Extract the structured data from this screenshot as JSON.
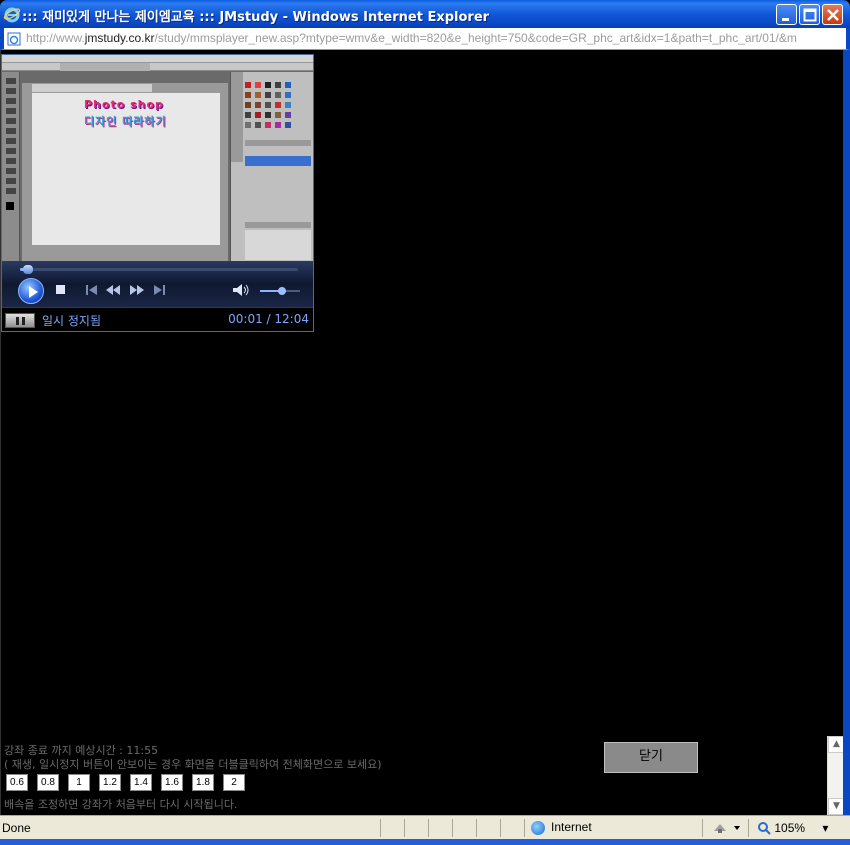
{
  "window": {
    "title": "::: 재미있게 만나는 제이엠교육 ::: JMstudy - Windows Internet Explorer"
  },
  "address": {
    "url_prefix": "http://www.",
    "url_host": "jmstudy.co.kr",
    "url_rest": "/study/mmsplayer_new.asp?mtype=wmv&e_width=820&e_height=750&code=GR_phc_art&idx=1&path=t_phc_art/01/&m"
  },
  "video": {
    "text_line1": "Photo shop",
    "text_line2": "디자인 따라하기"
  },
  "player": {
    "seek_progress": 0.02,
    "volume_level": 0.55,
    "status": "일시 정지됨",
    "time": "00:01 / 12:04"
  },
  "info": {
    "line1": "강좌 종료 까지 예상시간 : 11:55",
    "line2": "( 재생, 일시정지 버튼이 안보이는 경우 화면을 더블클릭하여 전체화면으로 보세요)",
    "line3": "배속을 조정하면 강좌가 처음부터 다시 시작됩니다."
  },
  "speeds": [
    "0.6",
    "0.8",
    "1",
    "1.2",
    "1.4",
    "1.6",
    "1.8",
    "2"
  ],
  "close_button": "닫기",
  "statusbar": {
    "status": "Done",
    "zone": "Internet",
    "zoom": "105%"
  },
  "colors": {
    "title_bar": "#0a47c4",
    "player_text": "#7aa6ff",
    "info_text": "#6a6a6a"
  }
}
